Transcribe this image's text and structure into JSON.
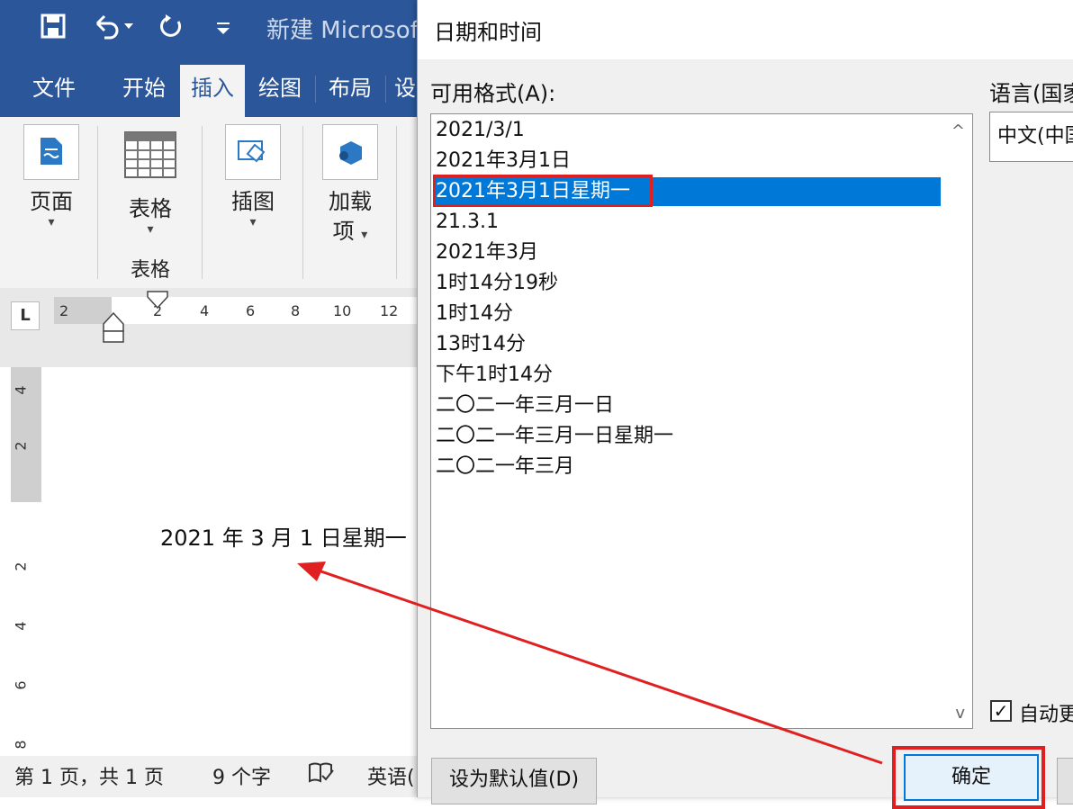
{
  "word": {
    "quick_access": {
      "save_icon": "save-icon",
      "undo_icon": "undo-icon",
      "redo_icon": "redo-icon",
      "customize_icon": "customize-icon"
    },
    "title": "新建 Microsoft",
    "tabs": [
      {
        "label": "文件"
      },
      {
        "label": "开始"
      },
      {
        "label": "插入",
        "active": true
      },
      {
        "label": "绘图"
      },
      {
        "label": "布局"
      },
      {
        "label": "设"
      }
    ],
    "ribbon": {
      "pages_label": "页面",
      "table_label": "表格",
      "table_group_label": "表格",
      "illustrations_label": "插图",
      "addins_label_1": "加载",
      "addins_label_2": "项"
    },
    "ruler": {
      "tabstop_glyph": "L",
      "h_ticks": [
        "2",
        "2",
        "4",
        "6",
        "8",
        "10",
        "12"
      ],
      "v_ticks": [
        "4",
        "2",
        "2",
        "4",
        "6",
        "8"
      ]
    },
    "document_text": "2021 年 3 月 1 日星期一",
    "status": {
      "page": "第 1 页，共 1 页",
      "words": "9 个字",
      "language": "英语("
    }
  },
  "dialog": {
    "title": "日期和时间",
    "formats_label": "可用格式(A):",
    "formats": [
      "2021/3/1",
      "2021年3月1日",
      "2021年3月1日星期一",
      "21.3.1",
      "2021年3月",
      "1时14分19秒",
      "1时14分",
      "13时14分",
      "下午1时14分",
      "二〇二一年三月一日",
      "二〇二一年三月一日星期一",
      "二〇二一年三月"
    ],
    "selected_index": 2,
    "language_label": "语言(国家",
    "language_value": "中文(中国",
    "auto_update_label": "自动更",
    "auto_update_checked": true,
    "set_default_label": "设为默认值(D)",
    "ok_label": "确定",
    "highlight_color": "#e02020",
    "selection_color": "#0078d7"
  }
}
